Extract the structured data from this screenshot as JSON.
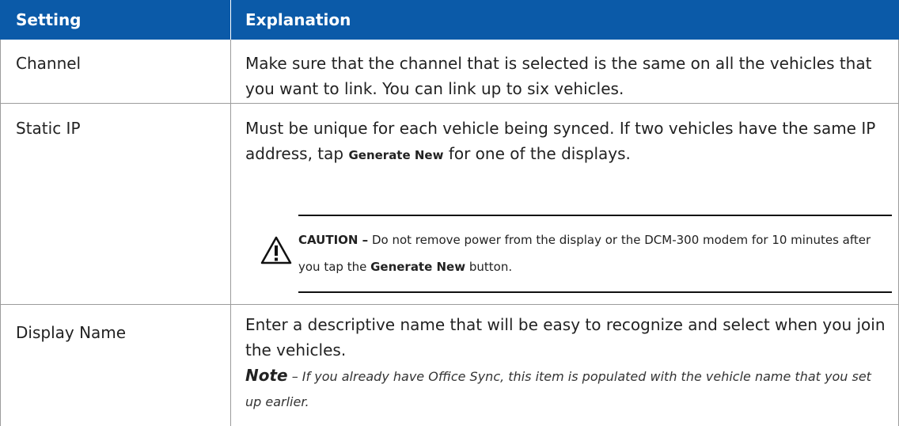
{
  "table": {
    "header": {
      "setting": "Setting",
      "explanation": "Explanation"
    },
    "rows": [
      {
        "setting": "Channel",
        "explanation": "Make sure that the channel that is selected is the same on all the vehicles that you want to link. You can link up to six vehicles."
      },
      {
        "setting": "Static IP",
        "explanation_before": "Must be unique for each vehicle being synced. If two vehicles have the same IP address, tap ",
        "explanation_button": "Generate New",
        "explanation_after": " for one of the displays.",
        "caution": {
          "label": "CAUTION –",
          "text_before": " Do not remove power from the display or the DCM-300 modem for 10 minutes after you tap the ",
          "button": "Generate New",
          "text_after": " button."
        }
      },
      {
        "setting": "Display Name",
        "explanation": "Enter a descriptive name that will be easy to recognize and select when you join the vehicles.",
        "note": {
          "label": "Note",
          "text": " – If you already have Office Sync, this item is populated with the vehicle name that you set up earlier."
        }
      }
    ]
  },
  "colors": {
    "header_bg": "#0b5aa8",
    "header_text": "#ffffff",
    "border": "#9c9c9c"
  },
  "icons": {
    "caution": "warning-triangle-icon"
  }
}
